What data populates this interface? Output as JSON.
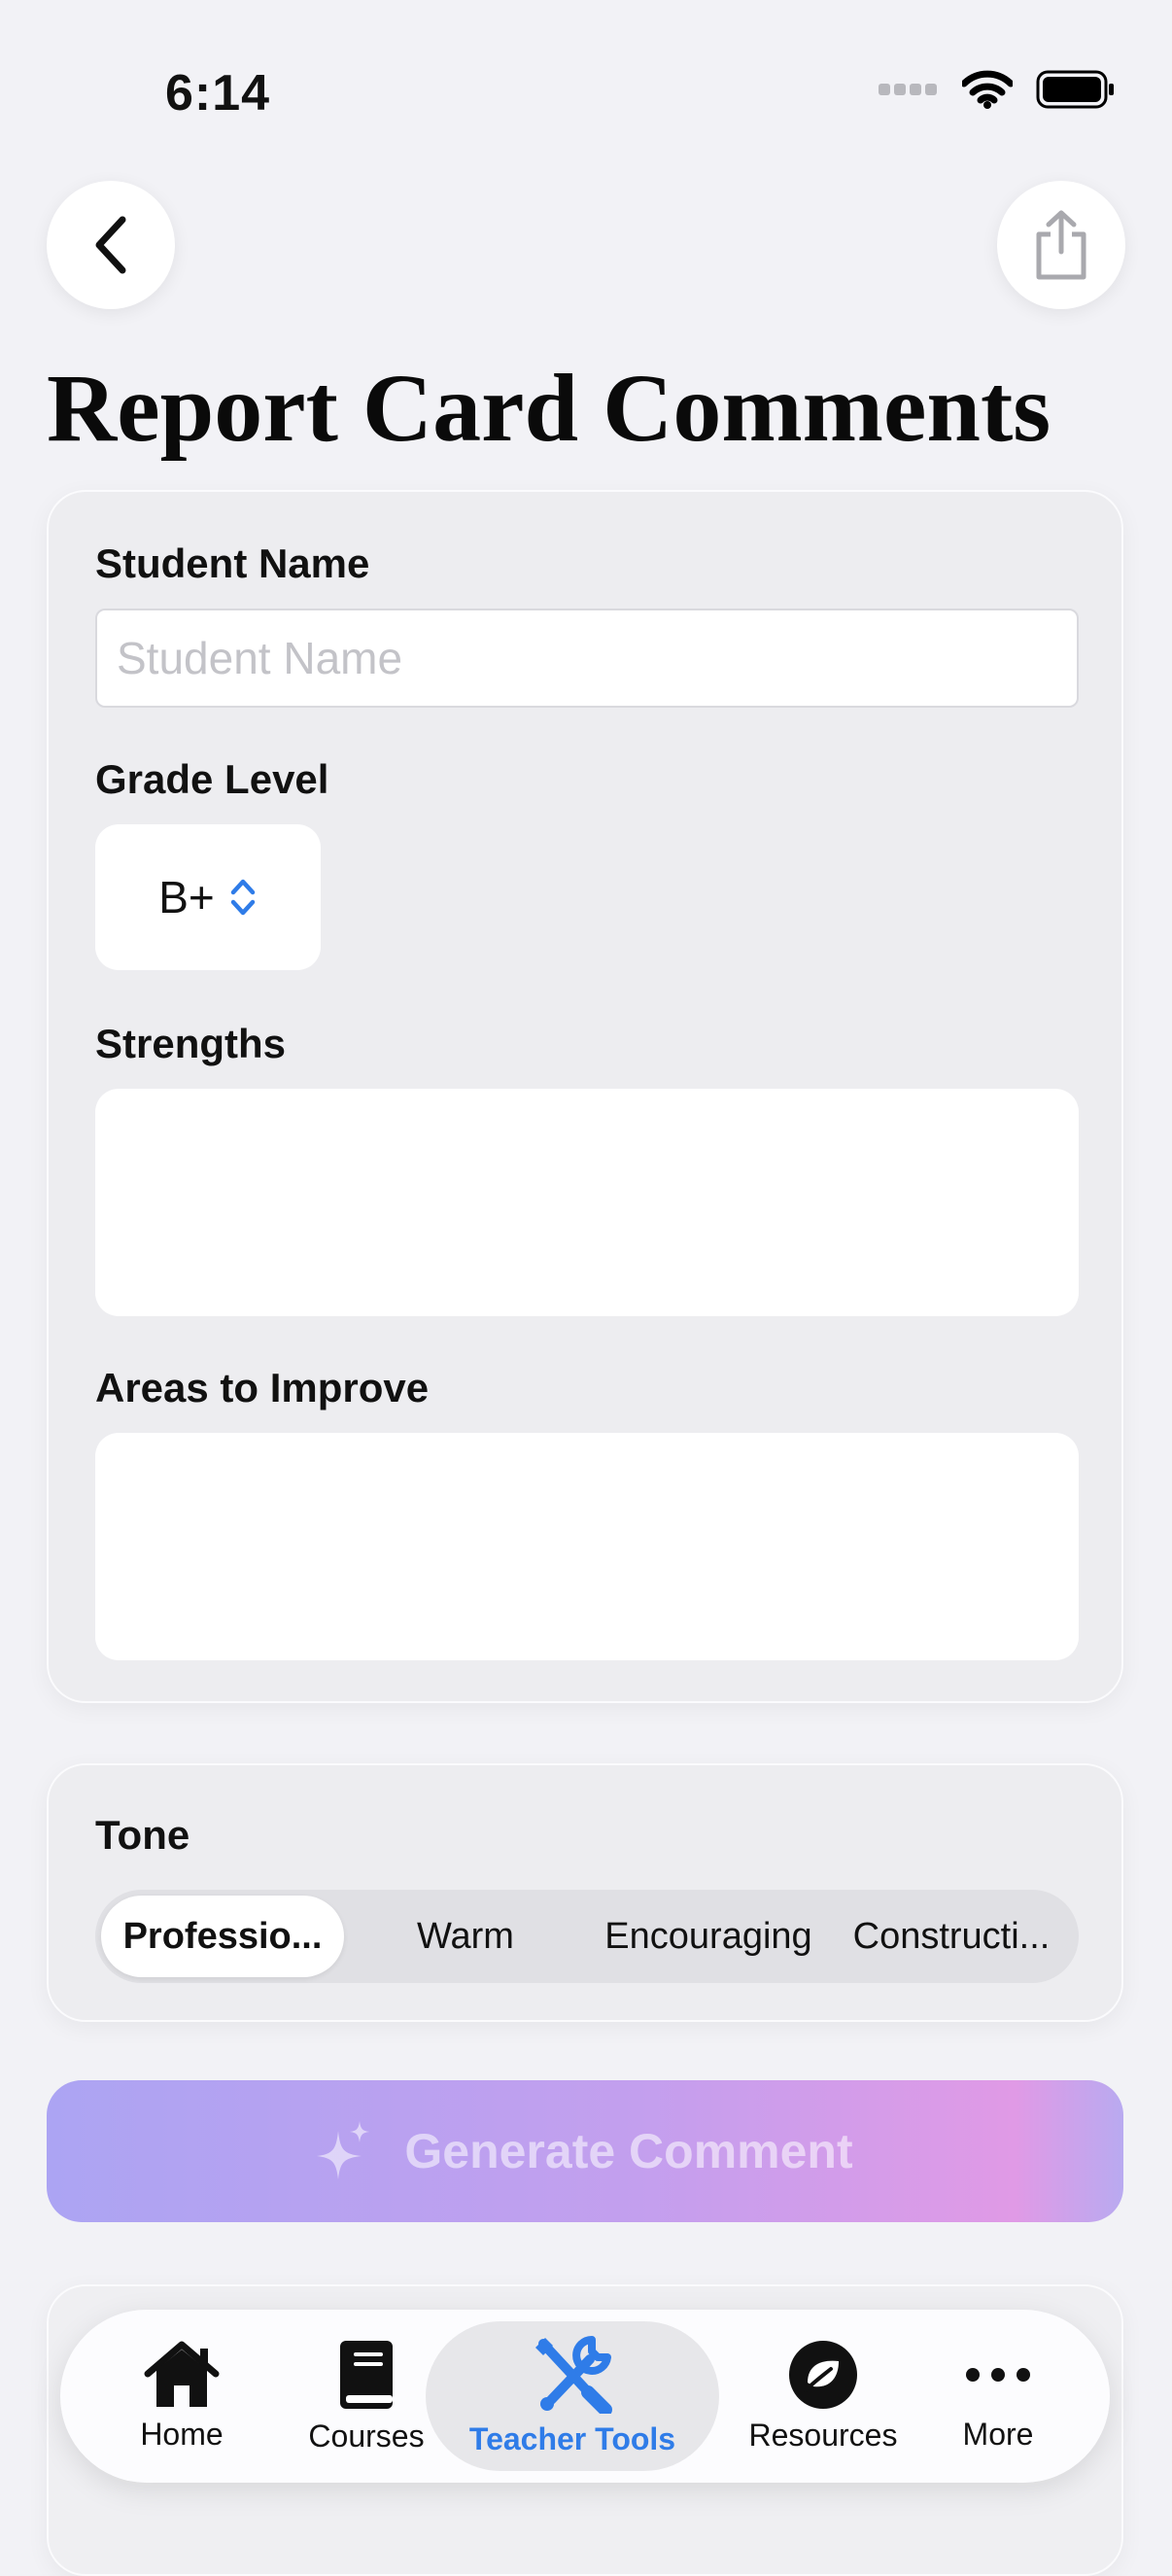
{
  "status": {
    "time": "6:14"
  },
  "header": {
    "title": "Report Card Comments"
  },
  "form": {
    "student_name_label": "Student Name",
    "student_name_placeholder": "Student Name",
    "grade_level_label": "Grade Level",
    "grade_value": "B+",
    "strengths_label": "Strengths",
    "areas_label": "Areas to Improve"
  },
  "tone": {
    "label": "Tone",
    "options": [
      "Professio...",
      "Warm",
      "Encouraging",
      "Constructi..."
    ],
    "selected": "Professio..."
  },
  "generate_button": {
    "label": "Generate Comment"
  },
  "tabbar": {
    "items": [
      {
        "label": "Home",
        "icon": "house-icon"
      },
      {
        "label": "Courses",
        "icon": "book-icon"
      },
      {
        "label": "Teacher Tools",
        "icon": "tools-icon"
      },
      {
        "label": "Resources",
        "icon": "leaf-icon"
      },
      {
        "label": "More",
        "icon": "ellipsis-icon"
      }
    ],
    "active": "Teacher Tools"
  },
  "colors": {
    "accent": "#2f7ce8",
    "background": "#f2f2f6",
    "card": "#ededf0"
  }
}
